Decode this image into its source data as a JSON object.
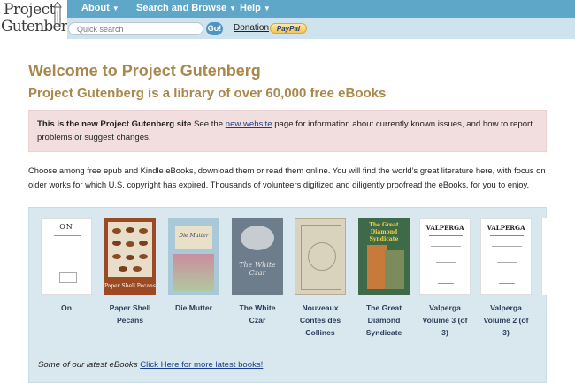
{
  "logo": {
    "line1": "Project",
    "line2": "Gutenberg"
  },
  "nav": {
    "about": "About",
    "search_browse": "Search and Browse",
    "help": "Help"
  },
  "search": {
    "placeholder": "Quick search",
    "go": "Go!"
  },
  "donation": {
    "label": "Donation",
    "paypal": "PayPal"
  },
  "page": {
    "title": "Welcome to Project Gutenberg",
    "subtitle": "Project Gutenberg is a library of over 60,000 free eBooks"
  },
  "notice": {
    "bold": "This is the new Project Gutenberg site",
    "pre": " See the ",
    "link": "new website",
    "post": " page for information about currently known issues, and how to report problems or suggest changes."
  },
  "intro": "Choose among free epub and Kindle eBooks, download them or read them online. You will find the world’s great literature here, with focus on older works for which U.S. copyright has expired. Thousands of volunteers digitized and diligently proofread the eBooks, for you to enjoy.",
  "books": [
    {
      "title": "On",
      "cover_text": "ON"
    },
    {
      "title": "Paper Shell Pecans",
      "cover_text": "Paper Shell Pecans"
    },
    {
      "title": "Die Mutter",
      "cover_text": "Die Mutter"
    },
    {
      "title": "The White Czar",
      "cover_text": "The White Czar"
    },
    {
      "title": "Nouveaux Contes des Collines",
      "cover_text": ""
    },
    {
      "title": "The Great Diamond Syndicate",
      "cover_text": "The Great Diamond Syndicate"
    },
    {
      "title": "Valperga Volume 3 (of 3)",
      "cover_text": "VALPERGA"
    },
    {
      "title": "Valperga Volume 2 (of 3)",
      "cover_text": "VALPERGA"
    }
  ],
  "latest": {
    "text": "Some of our latest eBooks ",
    "link": "Click Here for more latest books!"
  },
  "colors": {
    "nav": "#5fa7c9",
    "accent": "#a8884c",
    "notice_bg": "#f2dede",
    "books_bg": "#d9e7ef"
  }
}
